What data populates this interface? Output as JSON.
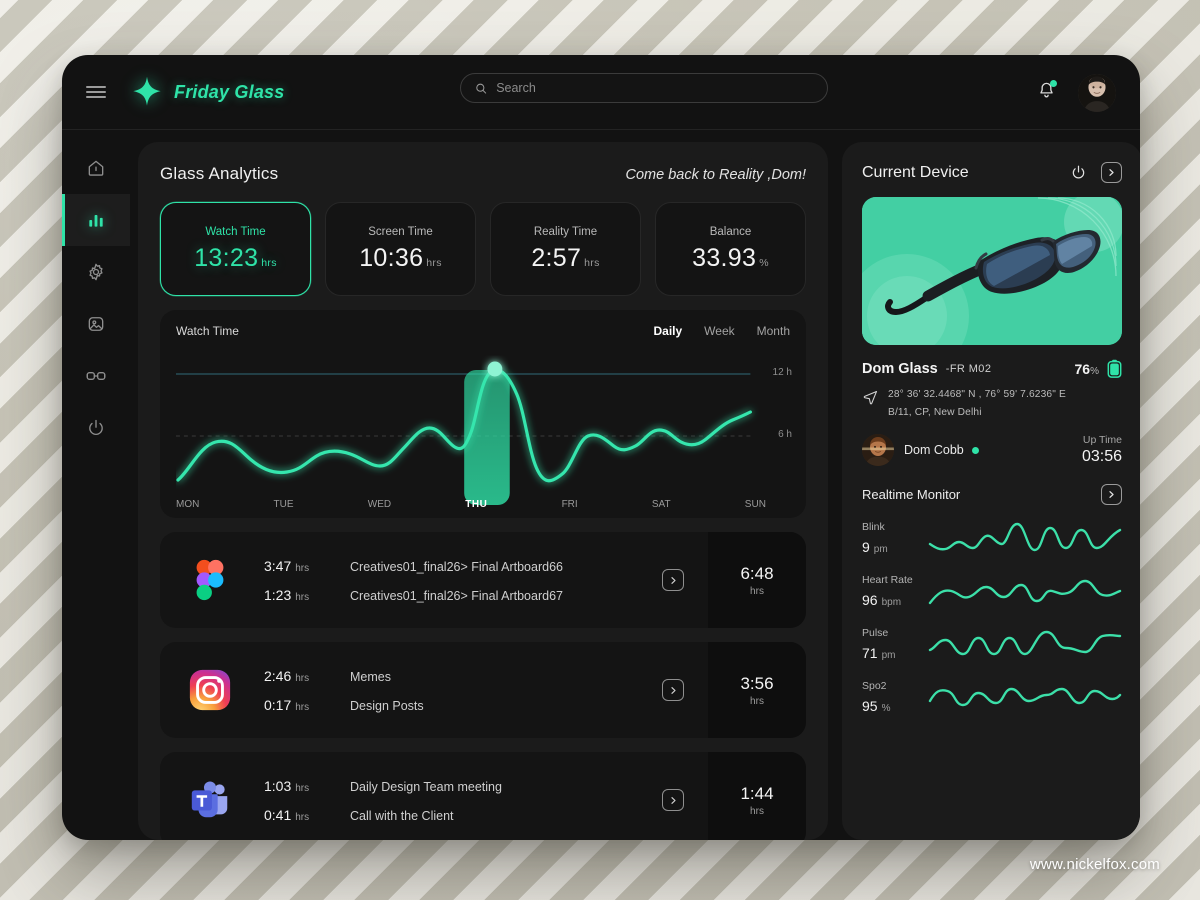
{
  "window": {
    "brand_name": "Friday Glass",
    "brand_logo_icon": "sparkle-icon",
    "menu_icon": "hamburger-menu-icon",
    "search": {
      "placeholder": "Search",
      "value": "",
      "icon": "search-icon"
    },
    "notifications_icon": "bell-icon",
    "avatar_icon": "user-avatar"
  },
  "sidebar": {
    "items": [
      {
        "name": "home",
        "icon": "home-icon",
        "active": false
      },
      {
        "name": "analytics",
        "icon": "bar-chart-icon",
        "active": true
      },
      {
        "name": "settings",
        "icon": "gear-icon",
        "active": false
      },
      {
        "name": "gallery",
        "icon": "image-icon",
        "active": false
      },
      {
        "name": "device",
        "icon": "glasses-icon",
        "active": false
      },
      {
        "name": "power",
        "icon": "power-icon",
        "active": false
      }
    ]
  },
  "analytics": {
    "title": "Glass Analytics",
    "greeting": "Come back to Reality ,Dom!",
    "stat_cards": [
      {
        "label": "Watch Time",
        "value": "13:23",
        "unit": "hrs",
        "active": true
      },
      {
        "label": "Screen Time",
        "value": "10:36",
        "unit": "hrs",
        "active": false
      },
      {
        "label": "Reality Time",
        "value": "2:57",
        "unit": "hrs",
        "active": false
      },
      {
        "label": "Balance",
        "value": "33.93",
        "unit": "%",
        "active": false
      }
    ],
    "chart": {
      "title": "Watch Time",
      "tabs": [
        {
          "label": "Daily",
          "active": true
        },
        {
          "label": "Week",
          "active": false
        },
        {
          "label": "Month",
          "active": false
        }
      ]
    },
    "app_rows": [
      {
        "app": "figma",
        "icon": "figma-icon",
        "entries": [
          {
            "time": "3:47",
            "unit": "hrs",
            "desc": "Creatives01_final26> Final Artboard66"
          },
          {
            "time": "1:23",
            "unit": "hrs",
            "desc": "Creatives01_final26> Final Artboard67"
          }
        ],
        "expand_icon": "chevron-right-icon",
        "total": "6:48",
        "total_unit": "hrs"
      },
      {
        "app": "instagram",
        "icon": "instagram-icon",
        "entries": [
          {
            "time": "2:46",
            "unit": "hrs",
            "desc": "Memes"
          },
          {
            "time": "0:17",
            "unit": "hrs",
            "desc": "Design Posts"
          }
        ],
        "expand_icon": "chevron-right-icon",
        "total": "3:56",
        "total_unit": "hrs"
      },
      {
        "app": "teams",
        "icon": "microsoft-teams-icon",
        "entries": [
          {
            "time": "1:03",
            "unit": "hrs",
            "desc": "Daily Design Team meeting"
          },
          {
            "time": "0:41",
            "unit": "hrs",
            "desc": "Call with the Client"
          }
        ],
        "expand_icon": "chevron-right-icon",
        "total": "1:44",
        "total_unit": "hrs"
      }
    ]
  },
  "device": {
    "title": "Current Device",
    "power_icon": "power-icon",
    "expand_icon": "chevron-right-icon",
    "image_alt": "smart-glasses-product-image",
    "name": "Dom Glass",
    "model": "-FR M02",
    "battery_pct": "76",
    "battery_unit": "%",
    "battery_icon": "battery-icon",
    "location_icon": "location-arrow-icon",
    "coordinates": "28° 36' 32.4468\" N , 76° 59' 7.6236\" E",
    "address": "B/11, CP, New Delhi",
    "user_name": "Dom Cobb",
    "user_status": "online",
    "uptime_label": "Up Time",
    "uptime_value": "03:56",
    "monitor": {
      "title": "Realtime Monitor",
      "expand_icon": "chevron-right-icon",
      "metrics": [
        {
          "name": "Blink",
          "value": "9",
          "unit": "pm"
        },
        {
          "name": "Heart Rate",
          "value": "96",
          "unit": "bpm"
        },
        {
          "name": "Pulse",
          "value": "71",
          "unit": "pm"
        },
        {
          "name": "Spo2",
          "value": "95",
          "unit": "%"
        }
      ]
    }
  },
  "footer": {
    "watermark": "www.nickelfox.com"
  },
  "colors": {
    "accent": "#2fe3a8",
    "panel": "#1b1b1b",
    "card": "#141414",
    "background": "#dedacd"
  },
  "chart_data": {
    "type": "line",
    "title": "Watch Time",
    "xlabel": "",
    "ylabel": "hours",
    "categories": [
      "MON",
      "TUE",
      "WED",
      "THU",
      "FRI",
      "SAT",
      "SUN"
    ],
    "x": [
      "MON",
      "TUE",
      "WED",
      "THU",
      "FRI",
      "SAT",
      "SUN"
    ],
    "values": [
      2.6,
      5.0,
      5.2,
      12.2,
      4.6,
      6.4,
      7.6
    ],
    "series": [
      {
        "name": "Watch Time",
        "values": [
          2.6,
          5.0,
          5.2,
          12.2,
          4.6,
          6.4,
          7.6
        ]
      }
    ],
    "detail_points": [
      {
        "x": 0.0,
        "y": 1.9
      },
      {
        "x": 0.08,
        "y": 4.0
      },
      {
        "x": 0.16,
        "y": 5.4
      },
      {
        "x": 0.24,
        "y": 4.0
      },
      {
        "x": 0.31,
        "y": 3.2
      },
      {
        "x": 0.39,
        "y": 3.4
      },
      {
        "x": 0.46,
        "y": 5.3
      },
      {
        "x": 0.52,
        "y": 4.6
      },
      {
        "x": 0.58,
        "y": 7.0
      },
      {
        "x": 0.63,
        "y": 5.6
      },
      {
        "x": 0.68,
        "y": 12.2
      },
      {
        "x": 0.75,
        "y": 12.3
      },
      {
        "x": 0.8,
        "y": 3.2
      },
      {
        "x": 0.86,
        "y": 6.2
      },
      {
        "x": 0.9,
        "y": 5.4
      },
      {
        "x": 0.94,
        "y": 6.6
      },
      {
        "x": 0.97,
        "y": 5.5
      },
      {
        "x": 1.0,
        "y": 7.6
      }
    ],
    "highlight": {
      "category": "THU",
      "value": 12.2,
      "label": "THU"
    },
    "ylim": [
      0,
      14
    ],
    "yticks": [
      6,
      12
    ],
    "ytick_labels": [
      "6 h",
      "12 h"
    ],
    "gridlines": [
      "6 h",
      "12 h"
    ],
    "grid": true,
    "legend": "none",
    "accent_color": "#2fe3a8"
  },
  "monitor_waves": {
    "type": "sparkline",
    "series": [
      {
        "name": "Blink",
        "points": [
          0.5,
          0.32,
          0.44,
          0.3,
          0.55,
          0.38,
          0.62,
          0.44,
          0.88,
          0.3,
          0.82,
          0.35,
          0.8,
          0.33,
          0.78,
          0.42,
          0.7
        ]
      },
      {
        "name": "Heart Rate",
        "points": [
          0.28,
          0.52,
          0.4,
          0.62,
          0.45,
          0.68,
          0.5,
          0.72,
          0.42,
          0.7,
          0.48,
          0.6,
          0.52,
          0.78,
          0.5,
          0.68,
          0.58
        ]
      },
      {
        "name": "Pulse",
        "points": [
          0.38,
          0.62,
          0.35,
          0.66,
          0.34,
          0.7,
          0.32,
          0.68,
          0.36,
          0.85,
          0.5,
          0.72,
          0.6,
          0.8,
          0.55,
          0.78,
          0.7
        ]
      },
      {
        "name": "Spo2",
        "points": [
          0.42,
          0.66,
          0.4,
          0.6,
          0.44,
          0.7,
          0.38,
          0.64,
          0.46,
          0.62,
          0.4,
          0.72,
          0.44,
          0.68,
          0.46,
          0.64,
          0.6
        ]
      }
    ]
  }
}
